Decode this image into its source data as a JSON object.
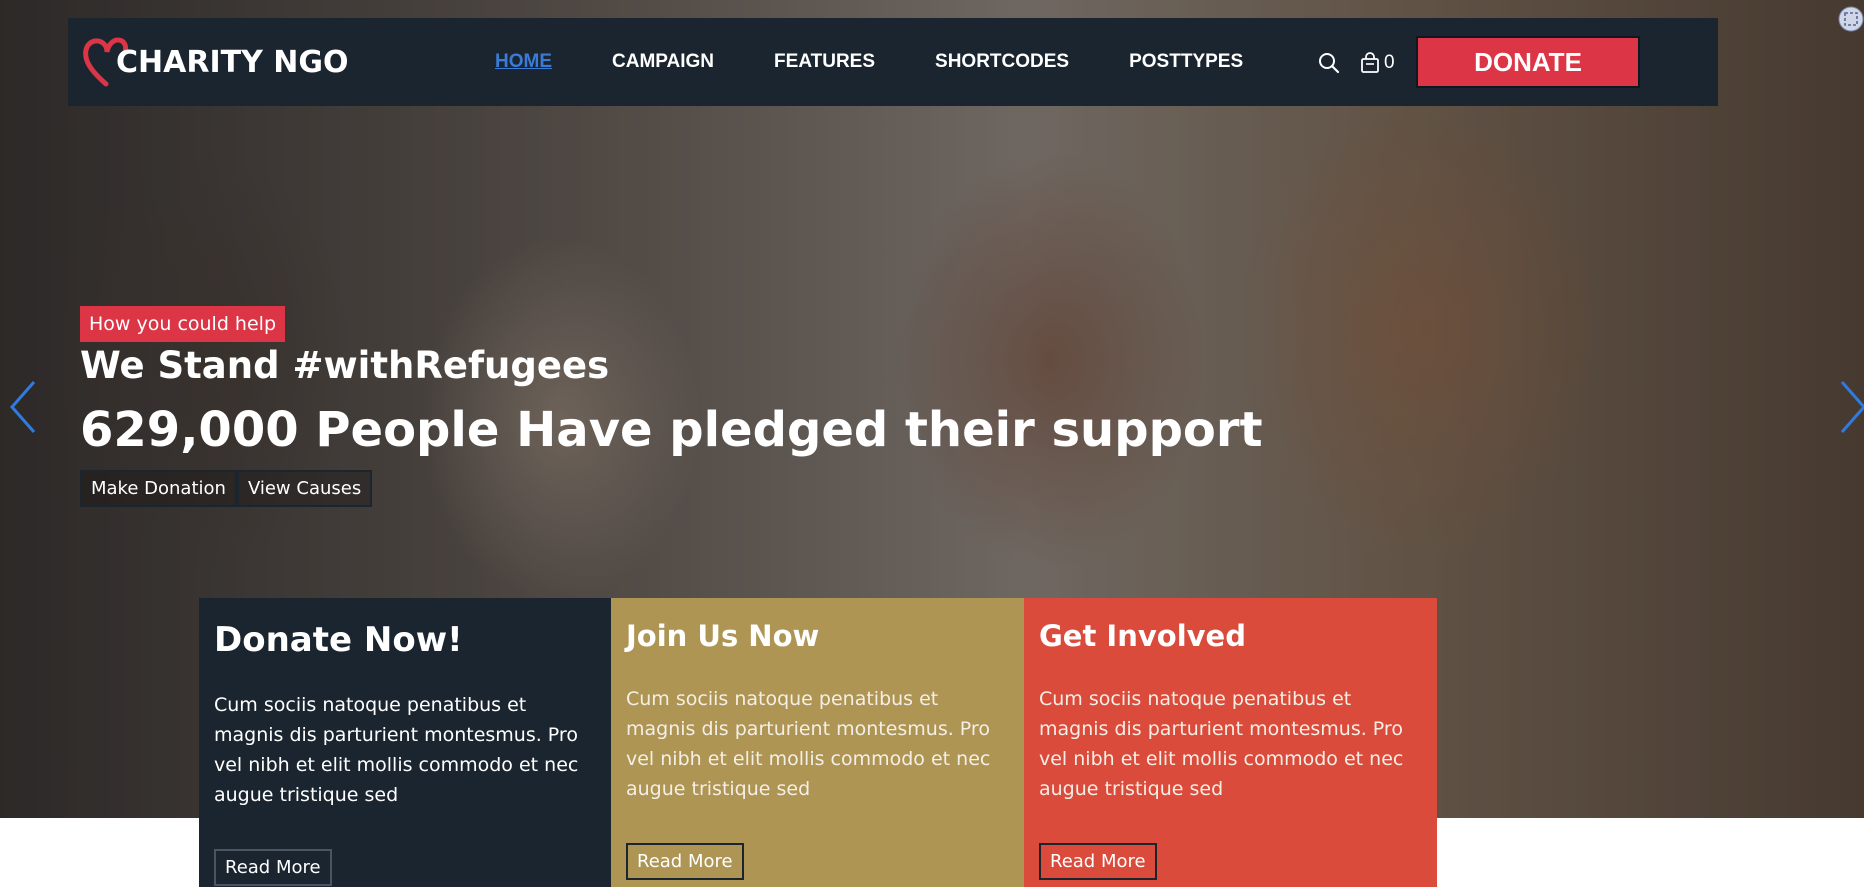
{
  "header": {
    "logo_text": "CHARITY NGO",
    "nav": [
      {
        "label": "HOME",
        "active": true
      },
      {
        "label": "CAMPAIGN",
        "active": false
      },
      {
        "label": "FEATURES",
        "active": false
      },
      {
        "label": "SHORTCODES",
        "active": false
      },
      {
        "label": "POSTTYPES",
        "active": false
      }
    ],
    "cart_count": "0",
    "donate_label": "DONATE"
  },
  "hero": {
    "tag": "How you could help",
    "subtitle": "We Stand #withRefugees",
    "title": "629,000 People Have pledged their support",
    "buttons": {
      "donation": "Make Donation",
      "causes": "View Causes"
    }
  },
  "cards": [
    {
      "title": "Donate Now!",
      "text": "Cum sociis natoque penatibus et magnis dis parturient montesmus. Pro vel nibh et elit mollis commodo et nec augue tristique sed",
      "button": "Read More",
      "color": "#1b2530"
    },
    {
      "title": "Join Us Now",
      "text": "Cum sociis natoque penatibus et magnis dis parturient montesmus. Pro vel nibh et elit mollis commodo et nec augue tristique sed",
      "button": "Read More",
      "color": "#ae9554"
    },
    {
      "title": "Get Involved",
      "text": "Cum sociis natoque penatibus et magnis dis parturient montesmus. Pro vel nibh et elit mollis commodo et nec augue tristique sed",
      "button": "Read More",
      "color": "#da4b3b"
    }
  ],
  "colors": {
    "brand_dark": "#1b2530",
    "accent_red": "#dc3545",
    "link_blue": "#3a7bd5"
  },
  "icons": [
    "heart-logo-icon",
    "search-icon",
    "cart-icon",
    "chevron-left-icon",
    "chevron-right-icon"
  ]
}
